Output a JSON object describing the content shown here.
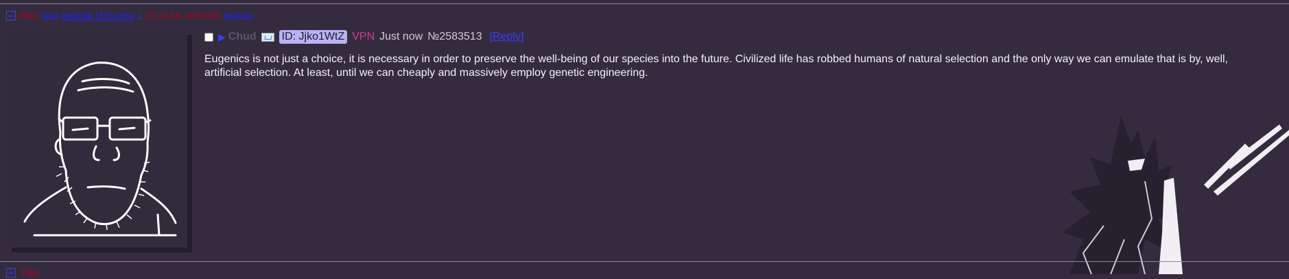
{
  "file_info": {
    "label": "File:",
    "hide_link": "hide",
    "filename": "neutral (15).png",
    "meta": "(31.52 KB, 300x300)",
    "imgops": "ImgOps"
  },
  "post": {
    "name": "Chud",
    "poster_id": "ID: Jjko1WtZ",
    "vpn": "VPN",
    "time": "Just now",
    "post_number": "№2583513",
    "reply_link": "[Reply]",
    "body": "Eugenics is not just a choice, it is necessary in order to preserve the well-being of our species into the future. Civilized life has robbed humans of natural selection and the only way we can emulate that is by, well, artificial selection. At least, until we can cheaply and massively employ genetic engineering."
  },
  "next_post": {
    "label": "File:"
  },
  "colors": {
    "background": "#342c3e",
    "link": "#1e22ff",
    "file_label": "#b00020",
    "id_badge": "#b9b2f4",
    "vpn": "#d53a98"
  },
  "icons": [
    "collapse-toggle-icon",
    "download-icon",
    "play-icon",
    "flag-icon"
  ]
}
